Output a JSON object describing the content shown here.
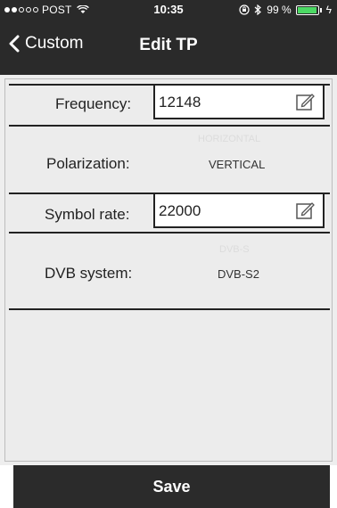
{
  "status": {
    "carrier": "POST",
    "time": "10:35",
    "battery_text": "99 %",
    "battery_level": 0.99,
    "signal_bars_filled": 2,
    "signal_bars_total": 5
  },
  "nav": {
    "back_label": "Custom",
    "title": "Edit TP"
  },
  "form": {
    "frequency": {
      "label": "Frequency:",
      "value": "12148"
    },
    "polarization": {
      "label": "Polarization:",
      "value": "VERTICAL",
      "ghost": "HORIZONTAL"
    },
    "symbol_rate": {
      "label": "Symbol rate:",
      "value": "22000"
    },
    "dvb_system": {
      "label": "DVB system:",
      "value": "DVB-S2",
      "ghost": "DVB-S"
    }
  },
  "save_label": "Save",
  "colors": {
    "dark": "#2a2a2a",
    "panel": "#eeeeee",
    "battery": "#4cd964"
  }
}
